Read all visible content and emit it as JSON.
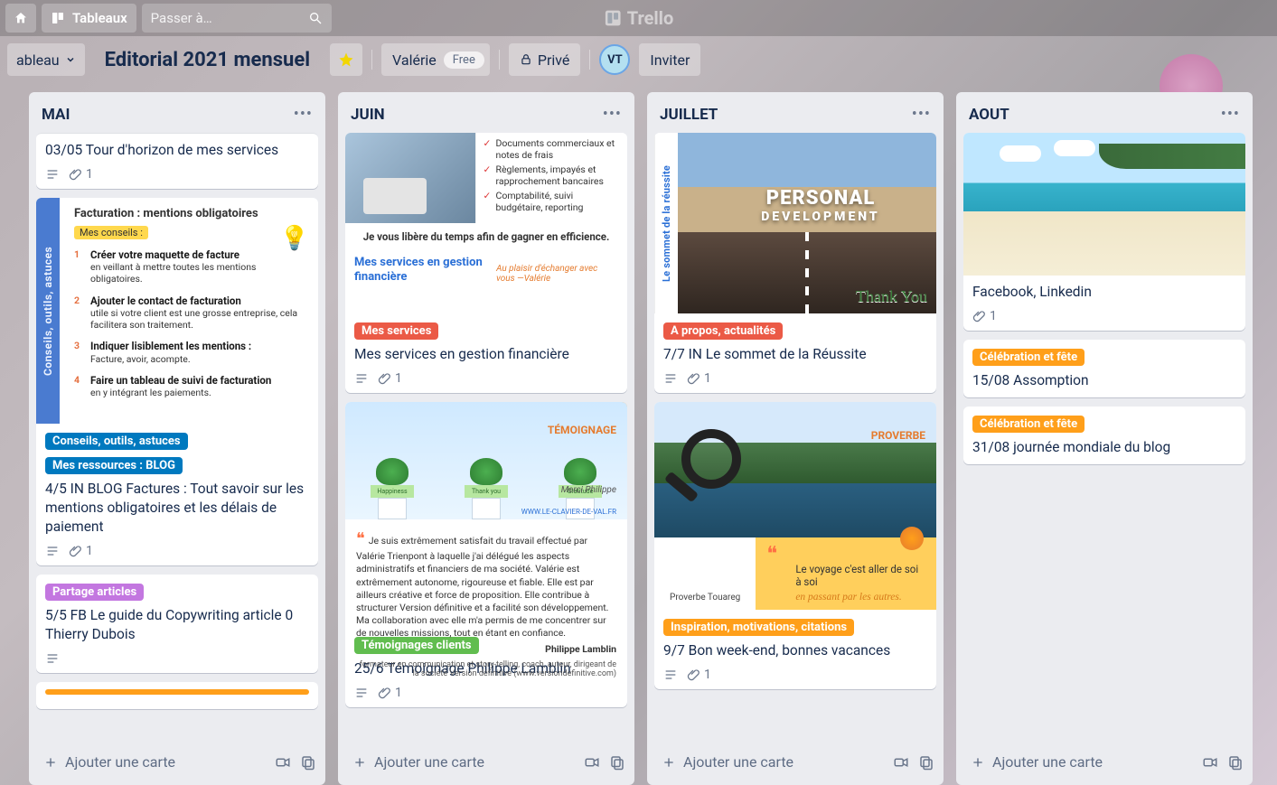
{
  "topbar": {
    "boards_label": "Tableaux",
    "search_placeholder": "Passer à…",
    "brand": "Trello"
  },
  "boardbar": {
    "board_dropdown": "ableau",
    "title": "Editorial 2021 mensuel",
    "workspace_user": "Valérie",
    "workspace_badge": "Free",
    "visibility": "Privé",
    "avatar_initials": "VT",
    "invite": "Inviter"
  },
  "lists": {
    "mai": {
      "title": "MAI",
      "add_card": "Ajouter une carte",
      "cards": {
        "c0": {
          "title": "03/05 Tour d'horizon de mes services",
          "attach": "1"
        },
        "c1": {
          "cover": {
            "band": "Conseils, outils, astuces",
            "heading": "Facturation : mentions obligatoires",
            "tag": "Mes conseils :",
            "items": [
              {
                "b": "Créer votre maquette de facture",
                "t": "en veillant à mettre toutes les mentions obligatoires."
              },
              {
                "b": "Ajouter le contact de facturation",
                "t": "utile si votre client est une grosse entreprise, cela facilitera son traitement."
              },
              {
                "b": "Indiquer lisiblement les mentions :",
                "t": "Facture, avoir, acompte."
              },
              {
                "b": "Faire un tableau de suivi de facturation",
                "t": "en y intégrant les paiements."
              }
            ]
          },
          "labels": [
            "Conseils, outils, astuces",
            "Mes ressources : BLOG"
          ],
          "title": "4/5 IN BLOG Factures : Tout savoir sur les mentions obligatoires et les délais de paiement",
          "attach": "1"
        },
        "c2": {
          "labels": [
            "Partage articles"
          ],
          "title": "5/5 FB Le guide du Copywriting article 0 Thierry Dubois"
        }
      }
    },
    "juin": {
      "title": "JUIN",
      "add_card": "Ajouter une carte",
      "cards": {
        "c0": {
          "cover": {
            "checks": [
              "Documents commerciaux et notes de frais",
              "Règlements, impayés et rapprochement bancaires",
              "Comptabilité, suivi budgétaire, reporting"
            ],
            "mid": "Je vous libère du temps afin de gagner en efficience.",
            "svc": "Mes services en gestion financière",
            "sig": "Au plaisir d'échanger avec vous  —Valérie"
          },
          "labels": [
            "Mes services"
          ],
          "title": "Mes services en gestion financière",
          "attach": "1"
        },
        "c1": {
          "cover": {
            "temo": "TÉMOIGNAGE",
            "merci": "Merci Philippe",
            "url": "WWW.LE-CLAVIER-DE-VAL.FR",
            "notes": [
              "Happiness",
              "Thank you",
              "Gratitude"
            ],
            "quote": "Je suis extrêmement satisfait du travail effectué par Valérie Trienpont à laquelle j'ai délégué les aspects administratifs et financiers de ma société. Valérie est extrêmement autonome, rigoureuse et fiable. Elle est par ailleurs créative et force de proposition. Elle contribue à structurer Version définitive et a facilité son développement. Ma collaboration avec elle m'a permis de me concentrer sur de nouvelles missions, tout en étant en confiance.",
            "author": "Philippe Lamblin",
            "role": "formateur en communication et story-telling, coach, auteur, dirigeant de la société Version définitive (www.versiondefinitive.com)"
          },
          "labels": [
            "Témoignages clients"
          ],
          "title": "25/6 Témoignage Philippe Lamblin",
          "attach": "1"
        }
      }
    },
    "juillet": {
      "title": "JUILLET",
      "add_card": "Ajouter une carte",
      "cards": {
        "c0": {
          "cover": {
            "band": "Le sommet de la réussite",
            "title_big": "PERSONAL",
            "title_small": "DEVELOPMENT",
            "thanks": "Thank You"
          },
          "labels": [
            "A propos, actualités"
          ],
          "title": "7/7 IN Le sommet de la Réussite",
          "attach": "1"
        },
        "c1": {
          "cover": {
            "prov": "PROVERBE",
            "bl": "Proverbe Touareg",
            "line1": "Le voyage c'est aller de soi à soi",
            "line2": "en passant par les autres."
          },
          "labels": [
            "Inspiration, motivations, citations"
          ],
          "title": "9/7 Bon week-end, bonnes vacances",
          "attach": "1"
        }
      }
    },
    "aout": {
      "title": "AOUT",
      "add_card": "Ajouter une carte",
      "cards": {
        "c0": {
          "title": "Facebook, Linkedin",
          "attach": "1"
        },
        "c1": {
          "labels": [
            "Célébration et fête"
          ],
          "title": "15/08 Assomption"
        },
        "c2": {
          "labels": [
            "Célébration et fête"
          ],
          "title": "31/08 journée mondiale du blog"
        }
      }
    }
  }
}
